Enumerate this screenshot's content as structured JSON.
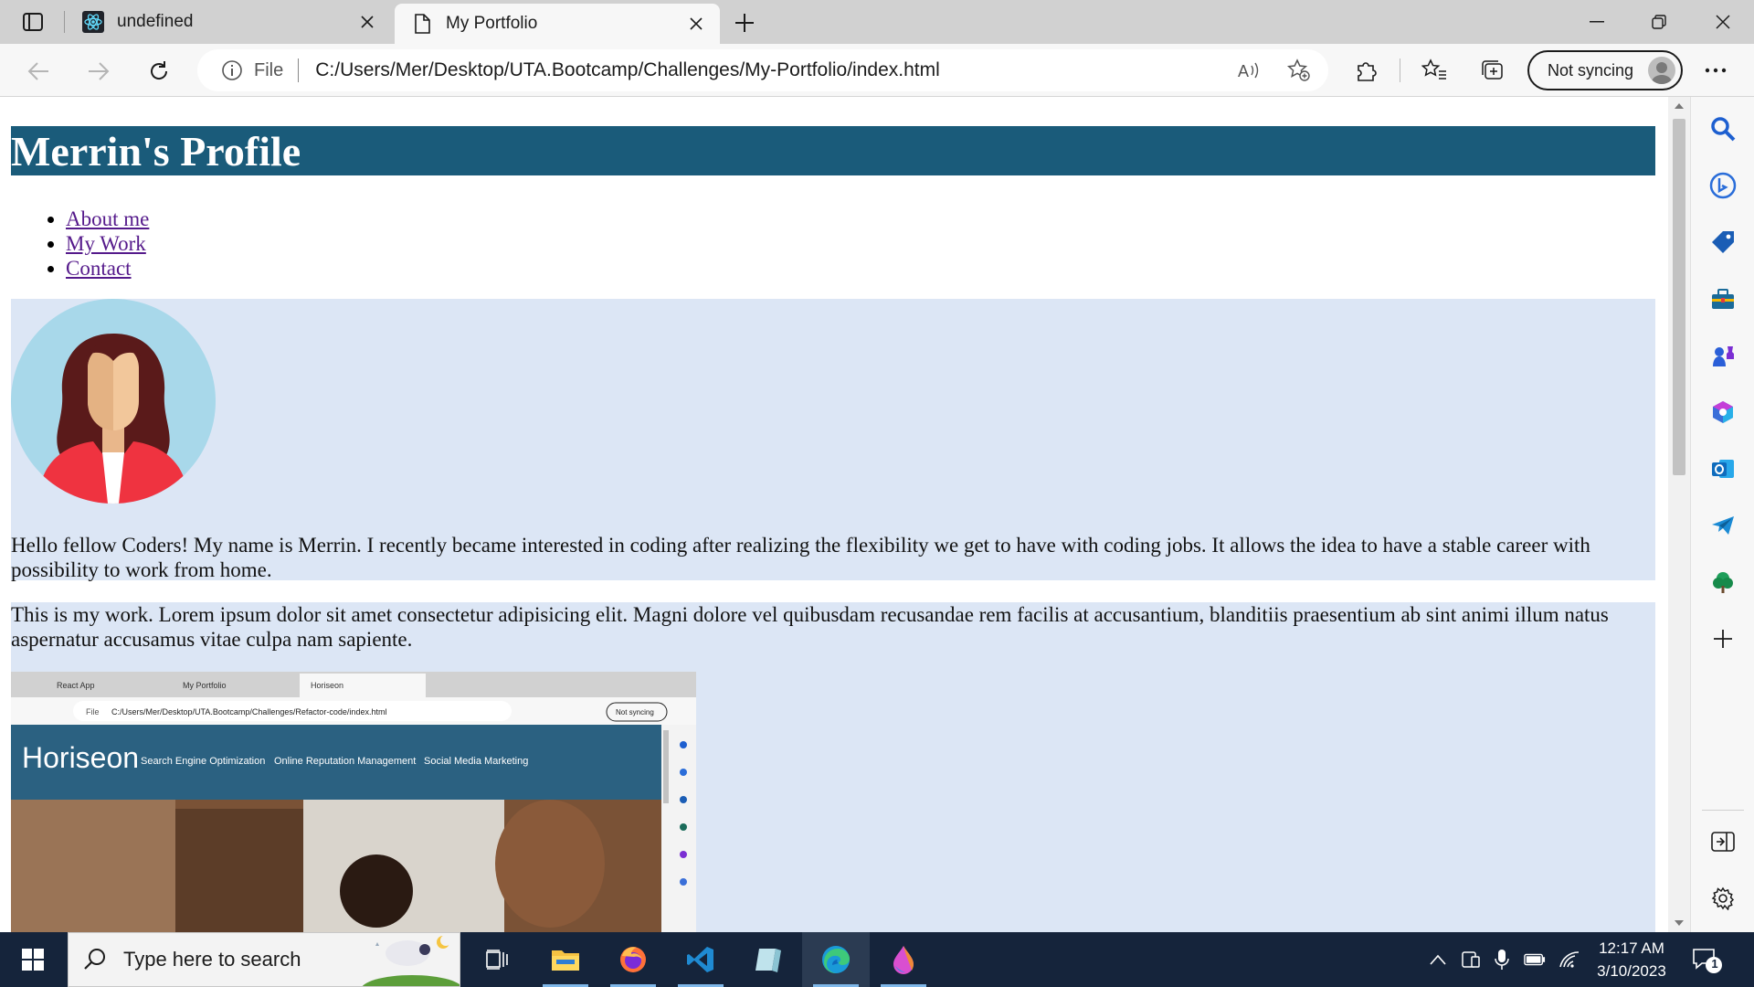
{
  "browser": {
    "tabs": [
      {
        "title": "undefined",
        "icon": "react-icon",
        "active": false
      },
      {
        "title": "My Portfolio",
        "icon": "page-icon",
        "active": true
      }
    ],
    "address": {
      "scheme_label": "File",
      "url": "C:/Users/Mer/Desktop/UTA.Bootcamp/Challenges/My-Portfolio/index.html"
    },
    "profile_button": "Not syncing",
    "sidebar_icons": [
      "search-icon",
      "bing-icon",
      "shopping-tag-icon",
      "tools-icon",
      "games-icon",
      "microsoft-365-icon",
      "outlook-icon",
      "telegram-icon",
      "tree-icon",
      "add-icon",
      "hide-sidebar-icon",
      "settings-icon"
    ]
  },
  "page": {
    "title": "Merrin's Profile",
    "nav": [
      "About me",
      "My Work",
      "Contact"
    ],
    "about_text": "Hello fellow Coders! My name is Merrin. I recently became interested in coding after realizing the flexibility we get to have with coding jobs. It allows the idea to have a stable career with possibility to work from home.",
    "work_text": "This is my work. Lorem ipsum dolor sit amet consectetur adipisicing elit. Magni dolore vel quibusdam recusandae rem facilis at accusantium, blanditiis praesentium ab sint animi illum natus aspernatur accusamus vitae culpa nam sapiente.",
    "screenshot": {
      "tabs": [
        "React App",
        "My Portfolio",
        "Horiseon"
      ],
      "file_label": "File",
      "url": "C:/Users/Mer/Desktop/UTA.Bootcamp/Challenges/Refactor-code/index.html",
      "sync_label": "Not syncing",
      "brand": "Horiseon",
      "nav": [
        "Search Engine Optimization",
        "Online Reputation Management",
        "Social Media Marketing"
      ]
    }
  },
  "taskbar": {
    "search_placeholder": "Type here to search",
    "apps": [
      "task-view-icon",
      "file-explorer-icon",
      "firefox-icon",
      "vscode-icon",
      "notepad-icon",
      "edge-icon",
      "paint-icon"
    ],
    "time": "12:17 AM",
    "date": "3/10/2023",
    "notification_count": "1"
  },
  "colors": {
    "header_bg": "#1a5b7a",
    "section_bg": "#dce6f5",
    "link": "#551a8b",
    "taskbar": "#15243b"
  }
}
